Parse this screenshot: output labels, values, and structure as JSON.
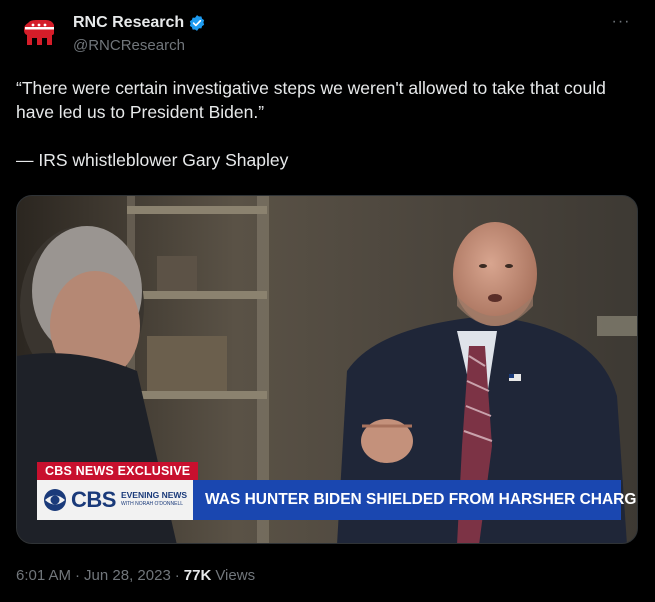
{
  "author": {
    "display_name": "RNC Research",
    "handle": "@RNCResearch",
    "verified": true,
    "avatar_icon": "gop-elephant-icon",
    "accent_color": "#d51d29",
    "verified_color": "#1d9bf0"
  },
  "more_label": "···",
  "tweet": {
    "quote": "“There were certain investigative steps we weren't allowed to take that could have led us to President Biden.”",
    "attribution": "— IRS whistleblower Gary Shapley"
  },
  "media": {
    "chyron_top": "CBS NEWS EXCLUSIVE",
    "network_logo": "CBS",
    "program_line1": "EVENING NEWS",
    "program_line2": "WITH NORAH O'DONNELL",
    "headline": "WAS HUNTER BIDEN SHIELDED FROM HARSHER CHARGES?",
    "chyron_red": "#c8102e",
    "chyron_blue": "#1a47b0"
  },
  "meta": {
    "time": "6:01 AM",
    "separator": "·",
    "date": "Jun 28, 2023",
    "views_count": "77K",
    "views_label": "Views"
  }
}
